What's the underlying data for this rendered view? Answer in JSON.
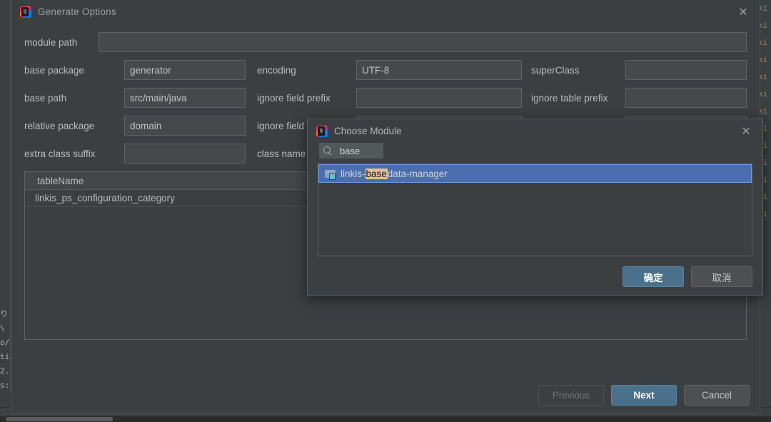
{
  "backdrop": {
    "left_code_lines": "り\n\\\no/\nti\n2.\ns:",
    "right_code_lines": "ki\nki\nki\nki\nki\nki\nki\nki\nki\nki\nki\nki\nki",
    "status_glyphs": "',\n'₃"
  },
  "generate_dialog": {
    "title": "Generate Options",
    "app_icon": "intellij-idea-icon",
    "close_icon": "close-icon",
    "fields": {
      "module_path": {
        "label": "module path",
        "value": "",
        "placeholder": ""
      },
      "base_package": {
        "label": "base package",
        "value": "generator",
        "placeholder": ""
      },
      "encoding": {
        "label": "encoding",
        "value": "UTF-8",
        "placeholder": ""
      },
      "super_class": {
        "label": "superClass",
        "value": "",
        "placeholder": ""
      },
      "base_path": {
        "label": "base path",
        "value": "src/main/java",
        "placeholder": ""
      },
      "ignore_field_prefix": {
        "label": "ignore field prefix",
        "value": "",
        "placeholder": ""
      },
      "ignore_table_prefix": {
        "label": "ignore table prefix",
        "value": "",
        "placeholder": ""
      },
      "relative_package": {
        "label": "relative package",
        "value": "domain",
        "placeholder": ""
      },
      "ignore_field_suffix": {
        "label": "ignore field s",
        "value": "",
        "placeholder": ""
      },
      "extra_class_suffix": {
        "label": "extra class suffix",
        "value": "",
        "placeholder": ""
      },
      "class_name_strategy": {
        "label": "class name st",
        "value": "",
        "placeholder": ""
      }
    },
    "table": {
      "columns": [
        "tableName"
      ],
      "rows": [
        [
          "linkis_ps_configuration_category"
        ]
      ]
    },
    "buttons": {
      "previous": "Previous",
      "next": "Next",
      "cancel": "Cancel"
    }
  },
  "choose_module_dialog": {
    "title": "Choose Module",
    "app_icon": "intellij-idea-icon",
    "close_icon": "close-icon",
    "subtitle": "e Module",
    "speed_search": {
      "icon": "search-icon",
      "value": "base"
    },
    "modules": [
      {
        "icon": "module-folder-icon",
        "prefix": "linkis-",
        "match": "base",
        "suffix": "data-manager",
        "selected": true
      }
    ],
    "buttons": {
      "ok": "确定",
      "cancel": "取消"
    }
  },
  "colors": {
    "dialog_bg": "#3c3f41",
    "input_bg": "#45494a",
    "accent_blue": "#4a708b",
    "selection_blue": "#4b6eaf",
    "match_highlight": "#e3c08d"
  }
}
